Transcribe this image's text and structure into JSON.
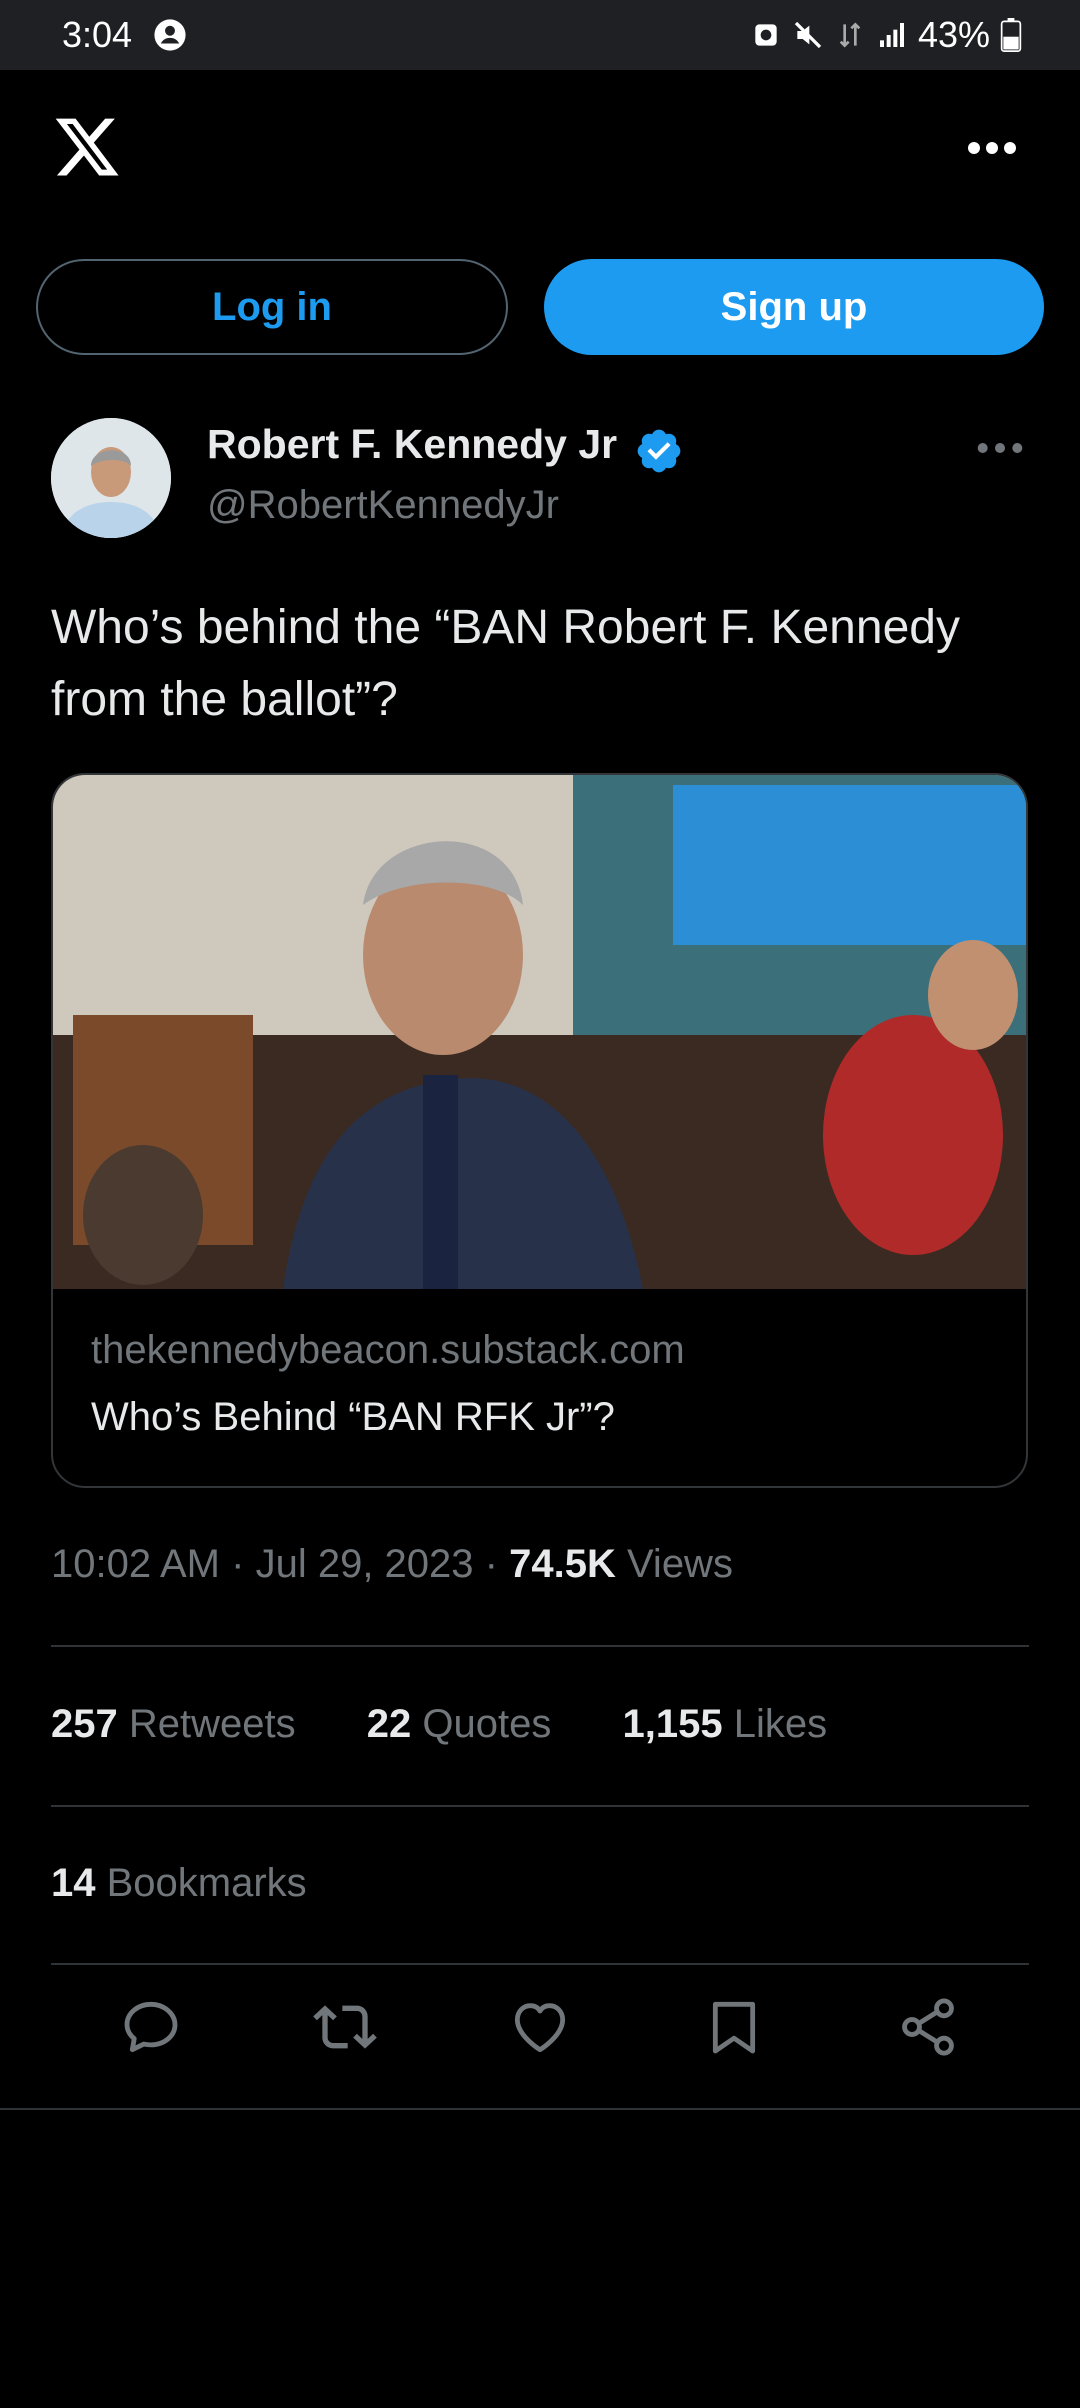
{
  "status_bar": {
    "time": "3:04",
    "battery": "43%",
    "icons": [
      "account-circle-icon",
      "notification-icon",
      "mute-icon",
      "data-icon",
      "signal-icon",
      "battery-icon"
    ]
  },
  "top_bar": {
    "logo": "x-logo-icon",
    "more": "more-icon"
  },
  "auth": {
    "login_label": "Log in",
    "signup_label": "Sign up"
  },
  "tweet": {
    "author": {
      "name": "Robert F. Kennedy Jr",
      "handle": "@RobertKennedyJr"
    },
    "text": "Who’s behind the “BAN Robert F. Kennedy from the ballot”?",
    "card": {
      "domain": "thekennedybeacon.substack.com",
      "title": "Who’s Behind “BAN RFK Jr”?"
    },
    "meta": {
      "time": "10:02 AM",
      "date": "Jul 29, 2023",
      "views_count": "74.5K",
      "views_label": "Views"
    },
    "stats": {
      "retweets_count": "257",
      "retweets_label": "Retweets",
      "quotes_count": "22",
      "quotes_label": "Quotes",
      "likes_count": "1,155",
      "likes_label": "Likes",
      "bookmarks_count": "14",
      "bookmarks_label": "Bookmarks"
    },
    "actions": [
      "reply-icon",
      "retweet-icon",
      "like-icon",
      "bookmark-icon",
      "share-icon"
    ]
  },
  "colors": {
    "accent": "#1d9bf0",
    "background": "#000000",
    "muted": "#71767b",
    "divider": "#2f3336"
  }
}
